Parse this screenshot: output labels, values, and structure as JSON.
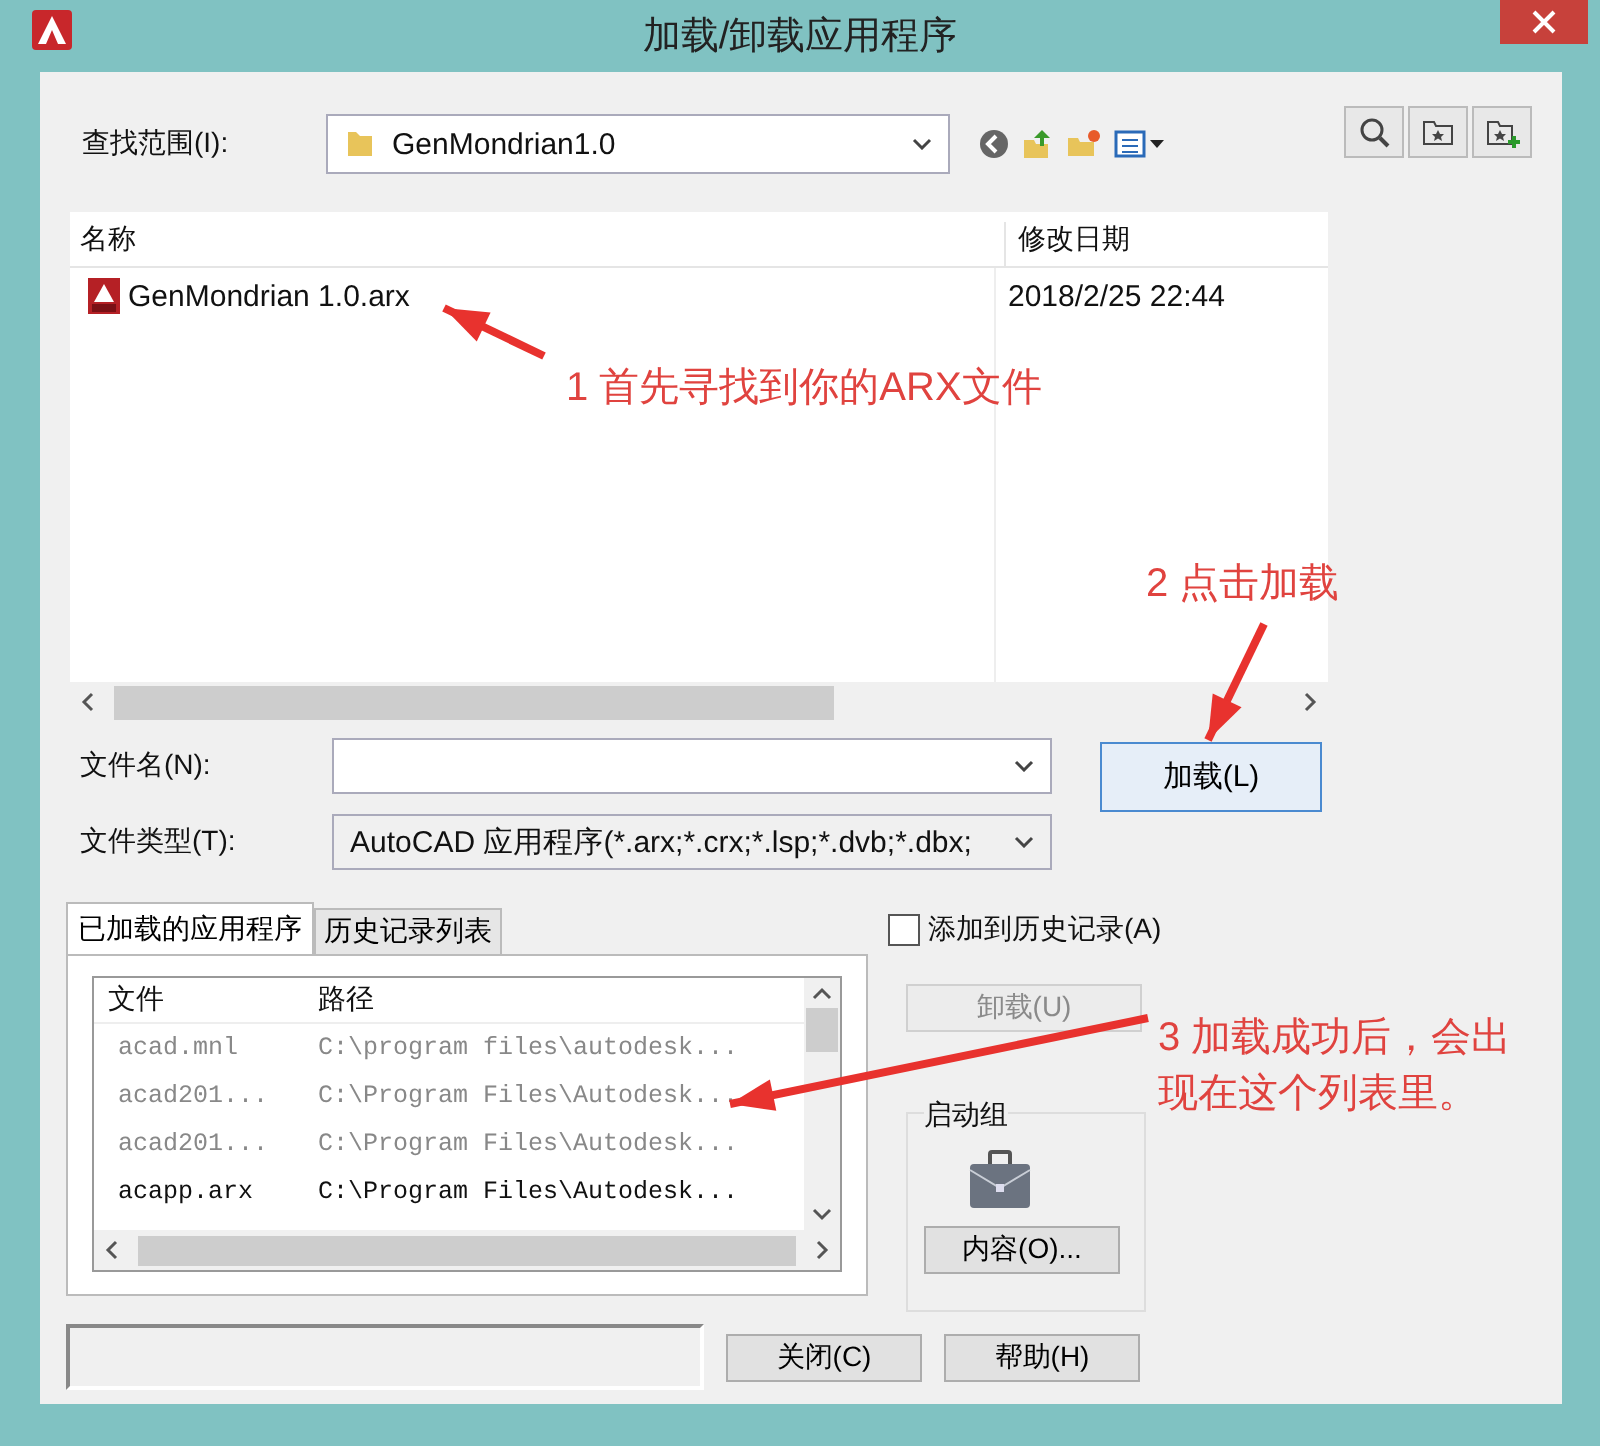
{
  "window": {
    "title": "加载/卸载应用程序"
  },
  "look_in": {
    "label": "查找范围(I):",
    "value": "GenMondrian1.0"
  },
  "file_list": {
    "columns": [
      "名称",
      "修改日期"
    ],
    "rows": [
      {
        "name": "GenMondrian 1.0.arx",
        "modified": "2018/2/25 22:44"
      }
    ]
  },
  "file_name": {
    "label": "文件名(N):"
  },
  "file_type": {
    "label": "文件类型(T):",
    "value": "AutoCAD 应用程序(*.arx;*.crx;*.lsp;*.dvb;*.dbx;"
  },
  "load_button": "加载(L)",
  "tabs": [
    {
      "label": "已加载的应用程序",
      "selected": true
    },
    {
      "label": "历史记录列表",
      "selected": false
    }
  ],
  "loaded_apps": {
    "columns": [
      "文件",
      "路径"
    ],
    "rows": [
      {
        "file": "acad.mnl",
        "path": "C:\\program files\\autodesk...",
        "dimmed": true
      },
      {
        "file": "acad201...",
        "path": "C:\\Program Files\\Autodesk...",
        "dimmed": true
      },
      {
        "file": "acad201...",
        "path": "C:\\Program Files\\Autodesk...",
        "dimmed": true
      },
      {
        "file": "acapp.arx",
        "path": "C:\\Program Files\\Autodesk...",
        "dimmed": false
      }
    ]
  },
  "add_to_history": {
    "label": "添加到历史记录(A)",
    "checked": false
  },
  "unload_button": {
    "label": "卸载(U)",
    "disabled": true
  },
  "startup_suite": {
    "title": "启动组",
    "button": "内容(O)..."
  },
  "buttons": [
    "关闭(C)",
    "帮助(H)"
  ],
  "annotations": [
    {
      "text": "1 首先寻找到你的ARX文件"
    },
    {
      "text": "2 点击加载"
    },
    {
      "text": "3 加载成功后，会出现在这个列表里。"
    }
  ]
}
